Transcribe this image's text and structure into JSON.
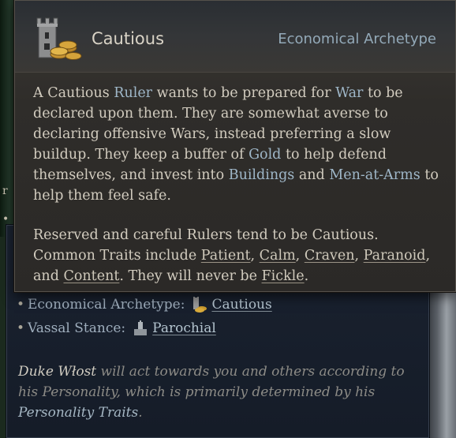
{
  "tooltip": {
    "title": "Cautious",
    "subtitle": "Economical Archetype",
    "icon": "tower-and-gold-coins-icon",
    "p1": {
      "t1": "A Cautious ",
      "k_ruler": "Ruler",
      "t2": " wants to be prepared for ",
      "k_war": "War",
      "t3": " to be declared upon them. They are somewhat averse to declaring offensive Wars, instead preferring a slow buildup. They keep a buffer of ",
      "k_gold": "Gold",
      "t4": " to help defend themselves, and invest into ",
      "k_buildings": "Buildings",
      "t5": " and ",
      "k_maa": "Men-at-Arms",
      "t6": " to help them feel safe."
    },
    "p2": {
      "t1": "Reserved and careful Rulers tend to be Cautious. Common Traits include ",
      "traits": [
        "Patient",
        "Calm",
        "Craven",
        "Paranoid",
        "Content"
      ],
      "sep": ", ",
      "and": ", and ",
      "t2": ". They will never be ",
      "never": "Fickle",
      "t3": "."
    }
  },
  "panel": {
    "bullet": "•",
    "rows": [
      {
        "label": "Economical Archetype:",
        "icon": "cautious-archetype-icon",
        "value": "Cautious"
      },
      {
        "label": "Vassal Stance:",
        "icon": "parochial-stance-icon",
        "value": "Parochial"
      }
    ],
    "desc": {
      "name": "Duke Włost",
      "t1": " will act towards you and others according to his ",
      "t2": "Personality",
      "t3": ", which is primarily determined by his ",
      "link": "Personality Traits",
      "t4": "."
    }
  },
  "background": {
    "left_marks": [
      "r",
      "•"
    ]
  }
}
